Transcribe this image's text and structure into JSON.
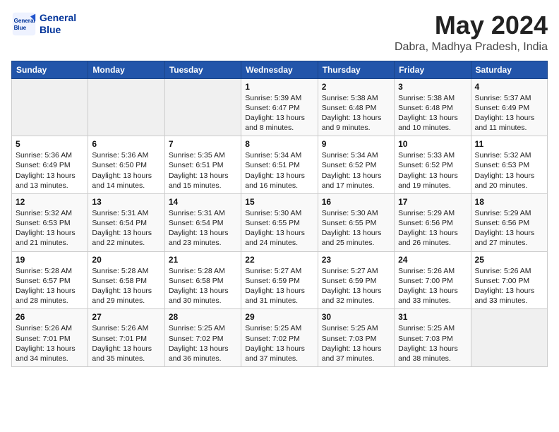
{
  "header": {
    "logo_line1": "General",
    "logo_line2": "Blue",
    "month_year": "May 2024",
    "location": "Dabra, Madhya Pradesh, India"
  },
  "calendar": {
    "days_of_week": [
      "Sunday",
      "Monday",
      "Tuesday",
      "Wednesday",
      "Thursday",
      "Friday",
      "Saturday"
    ],
    "weeks": [
      {
        "row_class": "week-row-1",
        "days": [
          {
            "date": "",
            "info": ""
          },
          {
            "date": "",
            "info": ""
          },
          {
            "date": "",
            "info": ""
          },
          {
            "date": "1",
            "info": "Sunrise: 5:39 AM\nSunset: 6:47 PM\nDaylight: 13 hours\nand 8 minutes."
          },
          {
            "date": "2",
            "info": "Sunrise: 5:38 AM\nSunset: 6:48 PM\nDaylight: 13 hours\nand 9 minutes."
          },
          {
            "date": "3",
            "info": "Sunrise: 5:38 AM\nSunset: 6:48 PM\nDaylight: 13 hours\nand 10 minutes."
          },
          {
            "date": "4",
            "info": "Sunrise: 5:37 AM\nSunset: 6:49 PM\nDaylight: 13 hours\nand 11 minutes."
          }
        ]
      },
      {
        "row_class": "week-row-2",
        "days": [
          {
            "date": "5",
            "info": "Sunrise: 5:36 AM\nSunset: 6:49 PM\nDaylight: 13 hours\nand 13 minutes."
          },
          {
            "date": "6",
            "info": "Sunrise: 5:36 AM\nSunset: 6:50 PM\nDaylight: 13 hours\nand 14 minutes."
          },
          {
            "date": "7",
            "info": "Sunrise: 5:35 AM\nSunset: 6:51 PM\nDaylight: 13 hours\nand 15 minutes."
          },
          {
            "date": "8",
            "info": "Sunrise: 5:34 AM\nSunset: 6:51 PM\nDaylight: 13 hours\nand 16 minutes."
          },
          {
            "date": "9",
            "info": "Sunrise: 5:34 AM\nSunset: 6:52 PM\nDaylight: 13 hours\nand 17 minutes."
          },
          {
            "date": "10",
            "info": "Sunrise: 5:33 AM\nSunset: 6:52 PM\nDaylight: 13 hours\nand 19 minutes."
          },
          {
            "date": "11",
            "info": "Sunrise: 5:32 AM\nSunset: 6:53 PM\nDaylight: 13 hours\nand 20 minutes."
          }
        ]
      },
      {
        "row_class": "week-row-3",
        "days": [
          {
            "date": "12",
            "info": "Sunrise: 5:32 AM\nSunset: 6:53 PM\nDaylight: 13 hours\nand 21 minutes."
          },
          {
            "date": "13",
            "info": "Sunrise: 5:31 AM\nSunset: 6:54 PM\nDaylight: 13 hours\nand 22 minutes."
          },
          {
            "date": "14",
            "info": "Sunrise: 5:31 AM\nSunset: 6:54 PM\nDaylight: 13 hours\nand 23 minutes."
          },
          {
            "date": "15",
            "info": "Sunrise: 5:30 AM\nSunset: 6:55 PM\nDaylight: 13 hours\nand 24 minutes."
          },
          {
            "date": "16",
            "info": "Sunrise: 5:30 AM\nSunset: 6:55 PM\nDaylight: 13 hours\nand 25 minutes."
          },
          {
            "date": "17",
            "info": "Sunrise: 5:29 AM\nSunset: 6:56 PM\nDaylight: 13 hours\nand 26 minutes."
          },
          {
            "date": "18",
            "info": "Sunrise: 5:29 AM\nSunset: 6:56 PM\nDaylight: 13 hours\nand 27 minutes."
          }
        ]
      },
      {
        "row_class": "week-row-4",
        "days": [
          {
            "date": "19",
            "info": "Sunrise: 5:28 AM\nSunset: 6:57 PM\nDaylight: 13 hours\nand 28 minutes."
          },
          {
            "date": "20",
            "info": "Sunrise: 5:28 AM\nSunset: 6:58 PM\nDaylight: 13 hours\nand 29 minutes."
          },
          {
            "date": "21",
            "info": "Sunrise: 5:28 AM\nSunset: 6:58 PM\nDaylight: 13 hours\nand 30 minutes."
          },
          {
            "date": "22",
            "info": "Sunrise: 5:27 AM\nSunset: 6:59 PM\nDaylight: 13 hours\nand 31 minutes."
          },
          {
            "date": "23",
            "info": "Sunrise: 5:27 AM\nSunset: 6:59 PM\nDaylight: 13 hours\nand 32 minutes."
          },
          {
            "date": "24",
            "info": "Sunrise: 5:26 AM\nSunset: 7:00 PM\nDaylight: 13 hours\nand 33 minutes."
          },
          {
            "date": "25",
            "info": "Sunrise: 5:26 AM\nSunset: 7:00 PM\nDaylight: 13 hours\nand 33 minutes."
          }
        ]
      },
      {
        "row_class": "week-row-5",
        "days": [
          {
            "date": "26",
            "info": "Sunrise: 5:26 AM\nSunset: 7:01 PM\nDaylight: 13 hours\nand 34 minutes."
          },
          {
            "date": "27",
            "info": "Sunrise: 5:26 AM\nSunset: 7:01 PM\nDaylight: 13 hours\nand 35 minutes."
          },
          {
            "date": "28",
            "info": "Sunrise: 5:25 AM\nSunset: 7:02 PM\nDaylight: 13 hours\nand 36 minutes."
          },
          {
            "date": "29",
            "info": "Sunrise: 5:25 AM\nSunset: 7:02 PM\nDaylight: 13 hours\nand 37 minutes."
          },
          {
            "date": "30",
            "info": "Sunrise: 5:25 AM\nSunset: 7:03 PM\nDaylight: 13 hours\nand 37 minutes."
          },
          {
            "date": "31",
            "info": "Sunrise: 5:25 AM\nSunset: 7:03 PM\nDaylight: 13 hours\nand 38 minutes."
          },
          {
            "date": "",
            "info": ""
          }
        ]
      }
    ]
  }
}
